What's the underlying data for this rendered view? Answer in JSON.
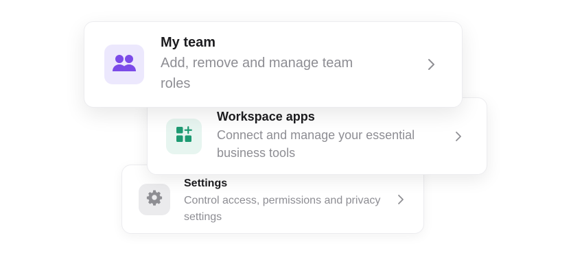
{
  "cards": [
    {
      "title": "My team",
      "description": "Add, remove and manage team roles",
      "icon": "users-icon",
      "icon_color": "#7b4be8",
      "tile_color": "#ece8fd"
    },
    {
      "title": "Workspace apps",
      "description": "Connect and manage your essential business tools",
      "icon": "apps-add-icon",
      "icon_color": "#1d9a72",
      "tile_color": "#e7f5f0"
    },
    {
      "title": "Settings",
      "description": "Control access, permissions and privacy settings",
      "icon": "gear-icon",
      "icon_color": "#8e8e93",
      "tile_color": "#ebebed"
    }
  ],
  "chevron_icon": "chevron-right-icon",
  "chevron_color": "#8e8e93"
}
